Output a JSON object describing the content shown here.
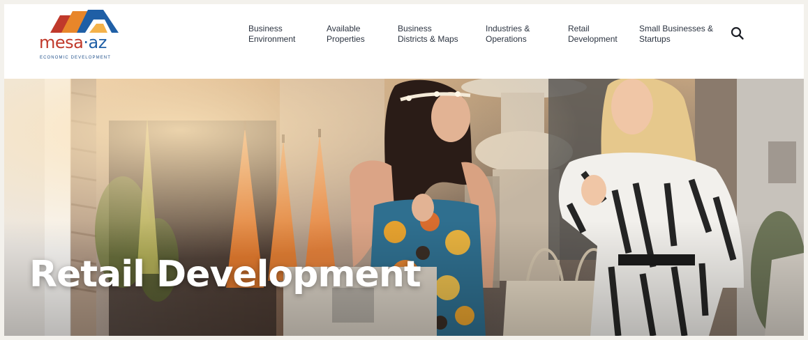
{
  "logo": {
    "word_part1": "mesa",
    "separator": "·",
    "word_part2": "az",
    "tagline": "ECONOMIC DEVELOPMENT"
  },
  "nav": {
    "items": [
      {
        "line1": "Business",
        "line2": "Environment"
      },
      {
        "line1": "Available",
        "line2": "Properties"
      },
      {
        "line1": "Business",
        "line2": "Districts & Maps"
      },
      {
        "line1": "Industries &",
        "line2": "Operations"
      },
      {
        "line1": "Retail",
        "line2": "Development"
      },
      {
        "line1": "Small Businesses &",
        "line2": "Startups"
      }
    ],
    "search_icon": "search-icon"
  },
  "hero": {
    "title": "Retail Development",
    "image": "hero-photo"
  },
  "colors": {
    "brand_red": "#c0392b",
    "brand_orange": "#e8862a",
    "brand_blue": "#1f5fa6",
    "nav_text": "#2b3340"
  }
}
